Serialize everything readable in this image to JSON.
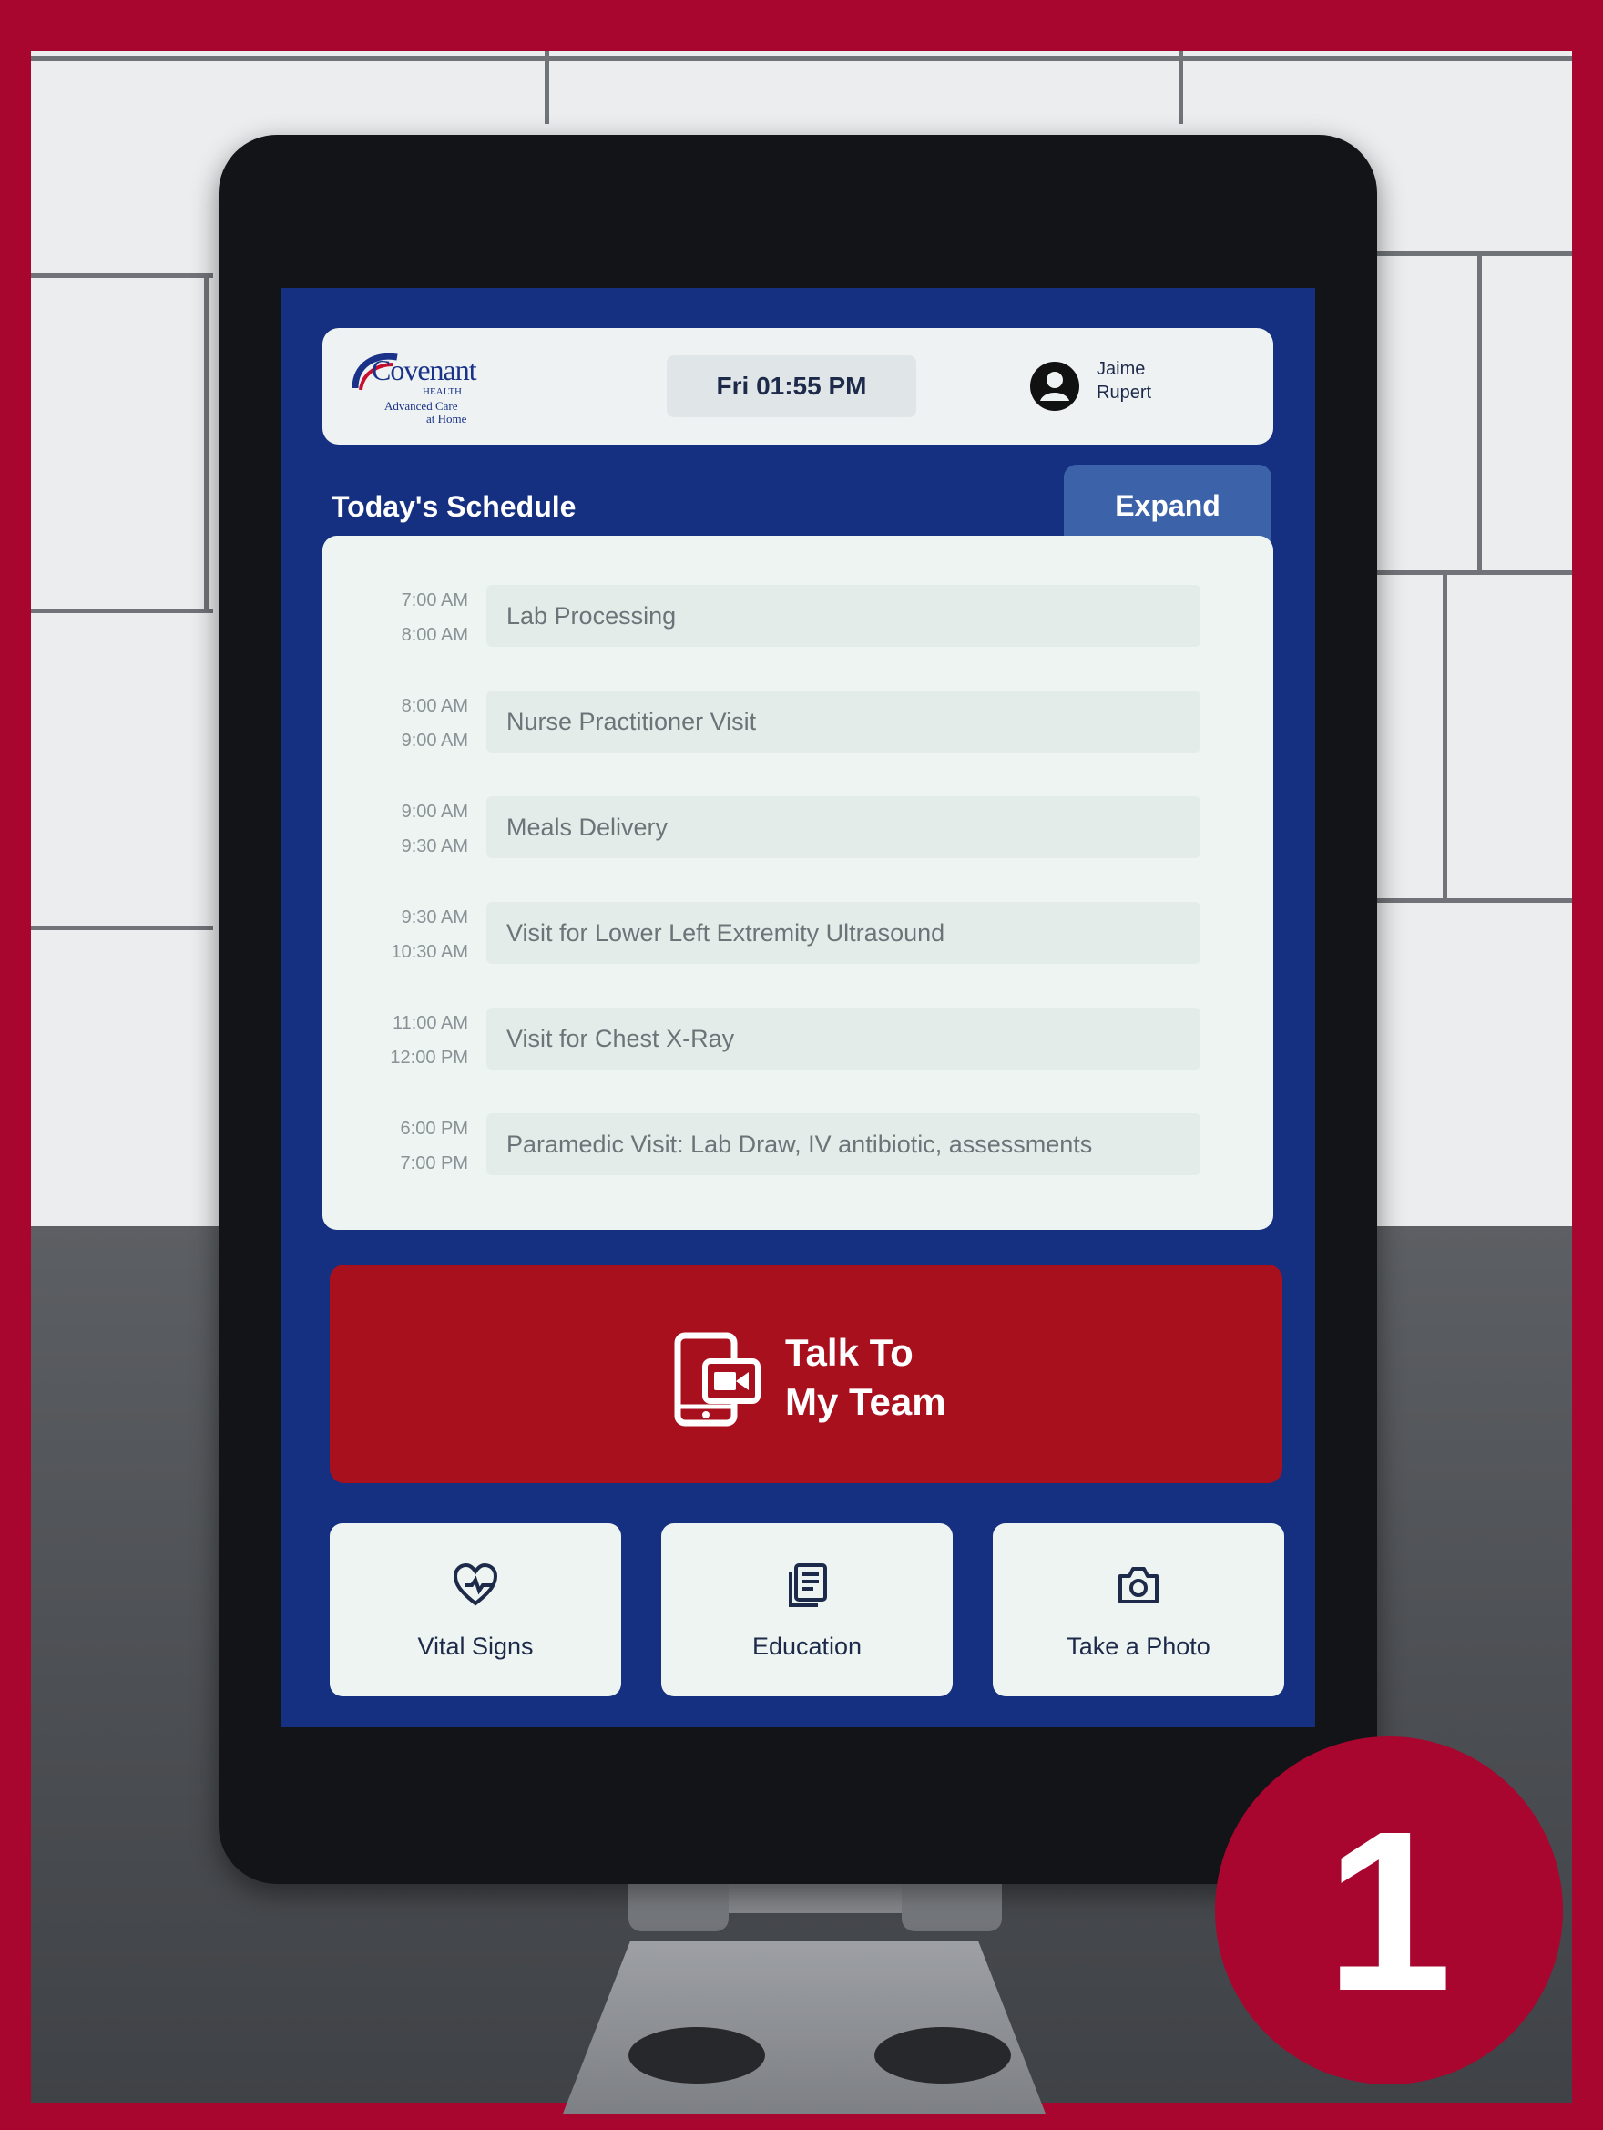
{
  "header": {
    "logo_brand": "Covenant",
    "logo_health": "HEALTH",
    "logo_line1": "Advanced Care",
    "logo_line2": "at Home",
    "datetime": "Fri 01:55 PM",
    "user_first": "Jaime",
    "user_last": "Rupert"
  },
  "schedule": {
    "title": "Today's Schedule",
    "expand_label": "Expand",
    "items": [
      {
        "start": "7:00 AM",
        "end": "8:00 AM",
        "event": "Lab Processing"
      },
      {
        "start": "8:00 AM",
        "end": "9:00 AM",
        "event": "Nurse Practitioner Visit"
      },
      {
        "start": "9:00 AM",
        "end": "9:30 AM",
        "event": "Meals Delivery"
      },
      {
        "start": "9:30 AM",
        "end": "10:30 AM",
        "event": "Visit for Lower Left Extremity Ultrasound"
      },
      {
        "start": "11:00 AM",
        "end": "12:00 PM",
        "event": "Visit for Chest X-Ray"
      },
      {
        "start": "6:00 PM",
        "end": "7:00 PM",
        "event": "Paramedic Visit: Lab Draw, IV antibiotic, assessments"
      }
    ]
  },
  "talk": {
    "line1": "Talk To",
    "line2": "My Team",
    "icon": "video-call-tablet-icon"
  },
  "tiles": [
    {
      "label": "Vital Signs",
      "icon": "heart-pulse-icon"
    },
    {
      "label": "Education",
      "icon": "document-list-icon"
    },
    {
      "label": "Take a Photo",
      "icon": "camera-icon"
    }
  ],
  "badge": {
    "number": "1"
  },
  "colors": {
    "screen_bg": "#163081",
    "talk_bg": "#a8101d",
    "expand_bg": "#3c63a9",
    "badge_bg": "#a8062f",
    "card_bg": "#edf4f1"
  }
}
